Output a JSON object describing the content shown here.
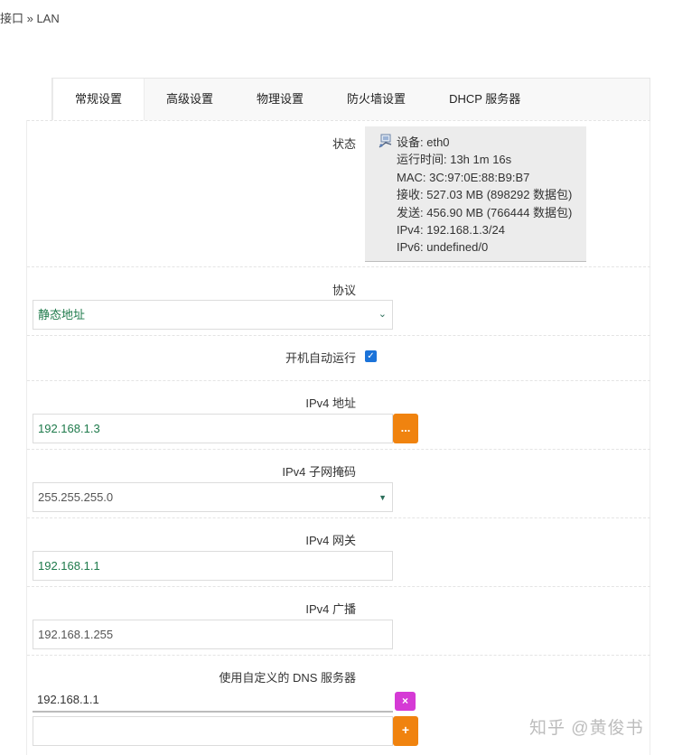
{
  "breadcrumb": "接口 » LAN",
  "tabs": [
    "常规设置",
    "高级设置",
    "物理设置",
    "防火墙设置",
    "DHCP 服务器"
  ],
  "status": {
    "label": "状态",
    "icon": "network-adapter-icon",
    "lines": [
      "设备: eth0",
      "运行时间: 13h 1m 16s",
      "MAC: 3C:97:0E:88:B9:B7",
      "接收: 527.03 MB (898292 数据包)",
      "发送: 456.90 MB (766444 数据包)",
      "IPv4: 192.168.1.3/24",
      "IPv6: undefined/0"
    ]
  },
  "protocol": {
    "label": "协议",
    "value": "静态地址"
  },
  "autostart": {
    "label": "开机自动运行",
    "checked": true
  },
  "ipv4_address": {
    "label": "IPv4 地址",
    "value": "192.168.1.3",
    "button": "..."
  },
  "ipv4_netmask": {
    "label": "IPv4 子网掩码",
    "value": "255.255.255.0"
  },
  "ipv4_gateway": {
    "label": "IPv4 网关",
    "value": "192.168.1.1"
  },
  "ipv4_broadcast": {
    "label": "IPv4 广播",
    "value": "192.168.1.255"
  },
  "dns": {
    "label": "使用自定义的 DNS 服务器",
    "value": "192.168.1.1",
    "remove_button": "×",
    "add_button": "+"
  },
  "watermark": "知乎 @黄俊书",
  "colors": {
    "accent_orange": "#f0830f",
    "remove_magenta": "#d53ad5",
    "value_green": "#1e7a4b",
    "checkbox_blue": "#1b73d9"
  }
}
